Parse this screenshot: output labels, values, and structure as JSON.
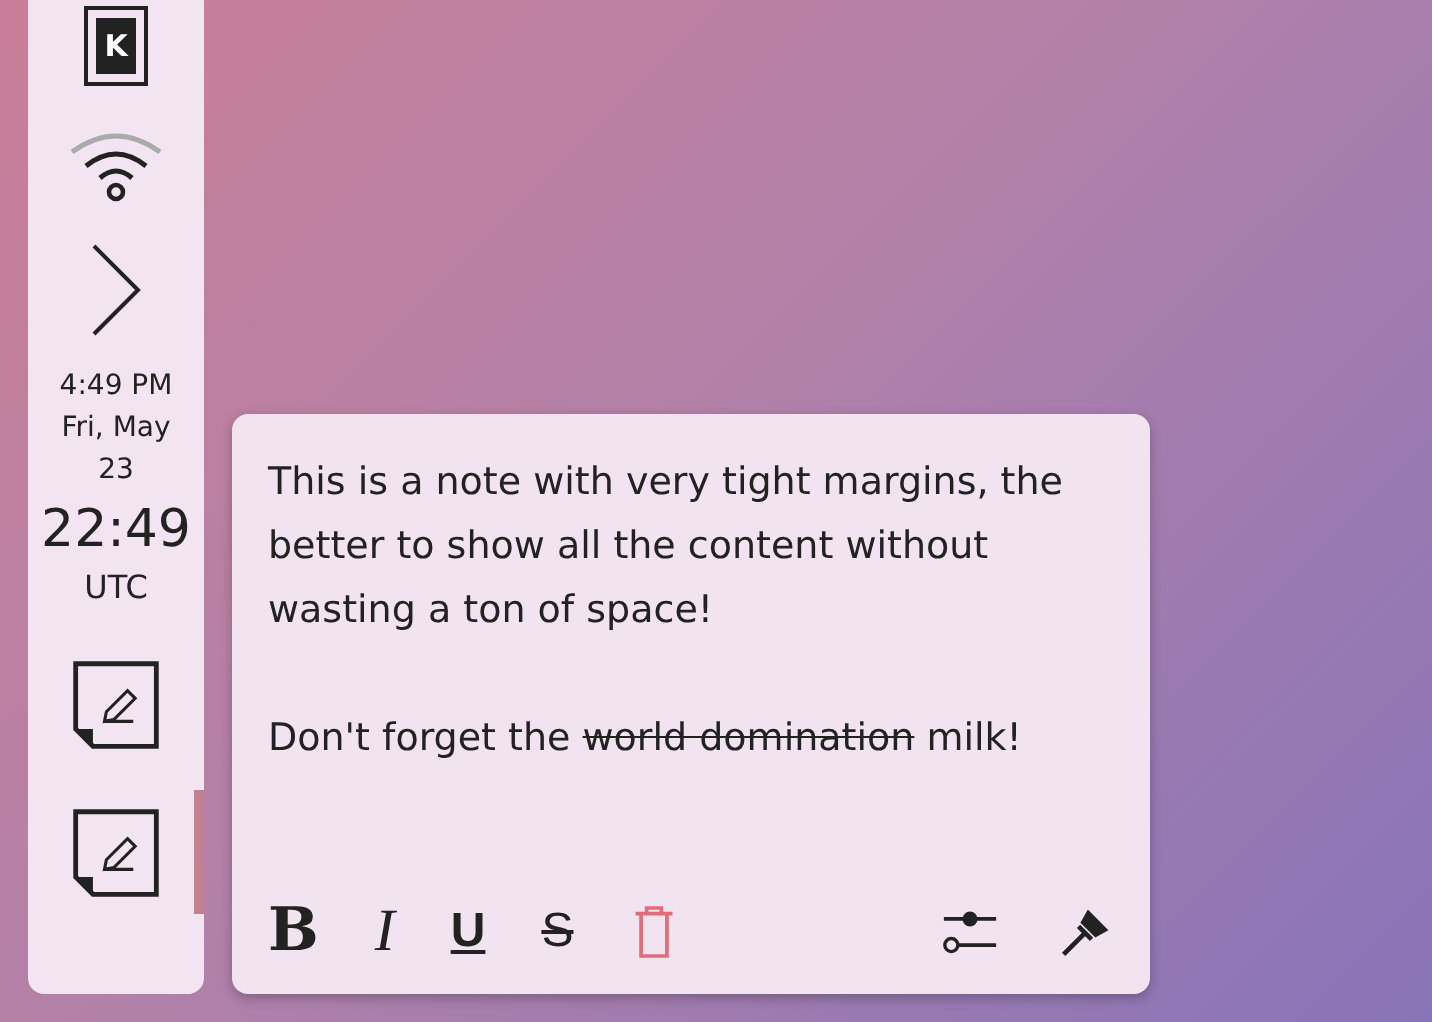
{
  "panel": {
    "logo": "K",
    "time": "4:49 PM",
    "date": "Fri, May 23",
    "clock": "22:49",
    "timezone": "UTC",
    "notes": [
      {
        "active": false
      },
      {
        "active": true
      }
    ]
  },
  "note": {
    "paragraphs": [
      [
        {
          "text": "This is a note with very tight margins, the better to show all the content without wasting a ton of space!",
          "struck": false
        }
      ],
      [
        {
          "text": "Don't forget the ",
          "struck": false
        },
        {
          "text": "world domination",
          "struck": true
        },
        {
          "text": " milk!",
          "struck": false
        }
      ]
    ],
    "format_buttons": [
      {
        "label": "B",
        "kind": "bold"
      },
      {
        "label": "I",
        "kind": "italic"
      },
      {
        "label": "U",
        "kind": "underline"
      },
      {
        "label": "S",
        "kind": "strike"
      }
    ]
  }
}
